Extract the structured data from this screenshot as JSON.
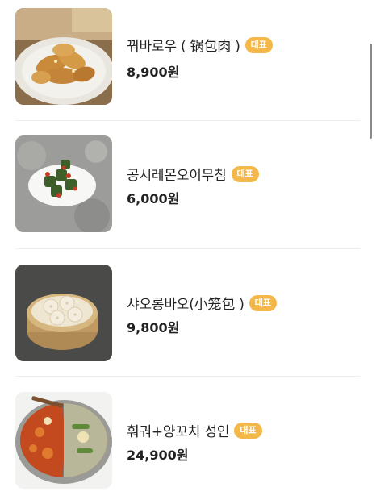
{
  "menu": {
    "items": [
      {
        "name": "꿔바로우 ( 锅包肉 )",
        "badge": "대표",
        "price": "8,900원",
        "image_icon": "crispy-pork-image"
      },
      {
        "name": "공시레몬오이무침",
        "badge": "대표",
        "price": "6,000원",
        "image_icon": "cucumber-salad-image"
      },
      {
        "name": "샤오롱바오(小笼包 )",
        "badge": "대표",
        "price": "9,800원",
        "image_icon": "dumpling-image"
      },
      {
        "name": "훠궈+양꼬치 성인",
        "badge": "대표",
        "price": "24,900원",
        "image_icon": "hotpot-image"
      }
    ]
  },
  "colors": {
    "badge": "#f4b84a",
    "divider": "#efefef"
  }
}
